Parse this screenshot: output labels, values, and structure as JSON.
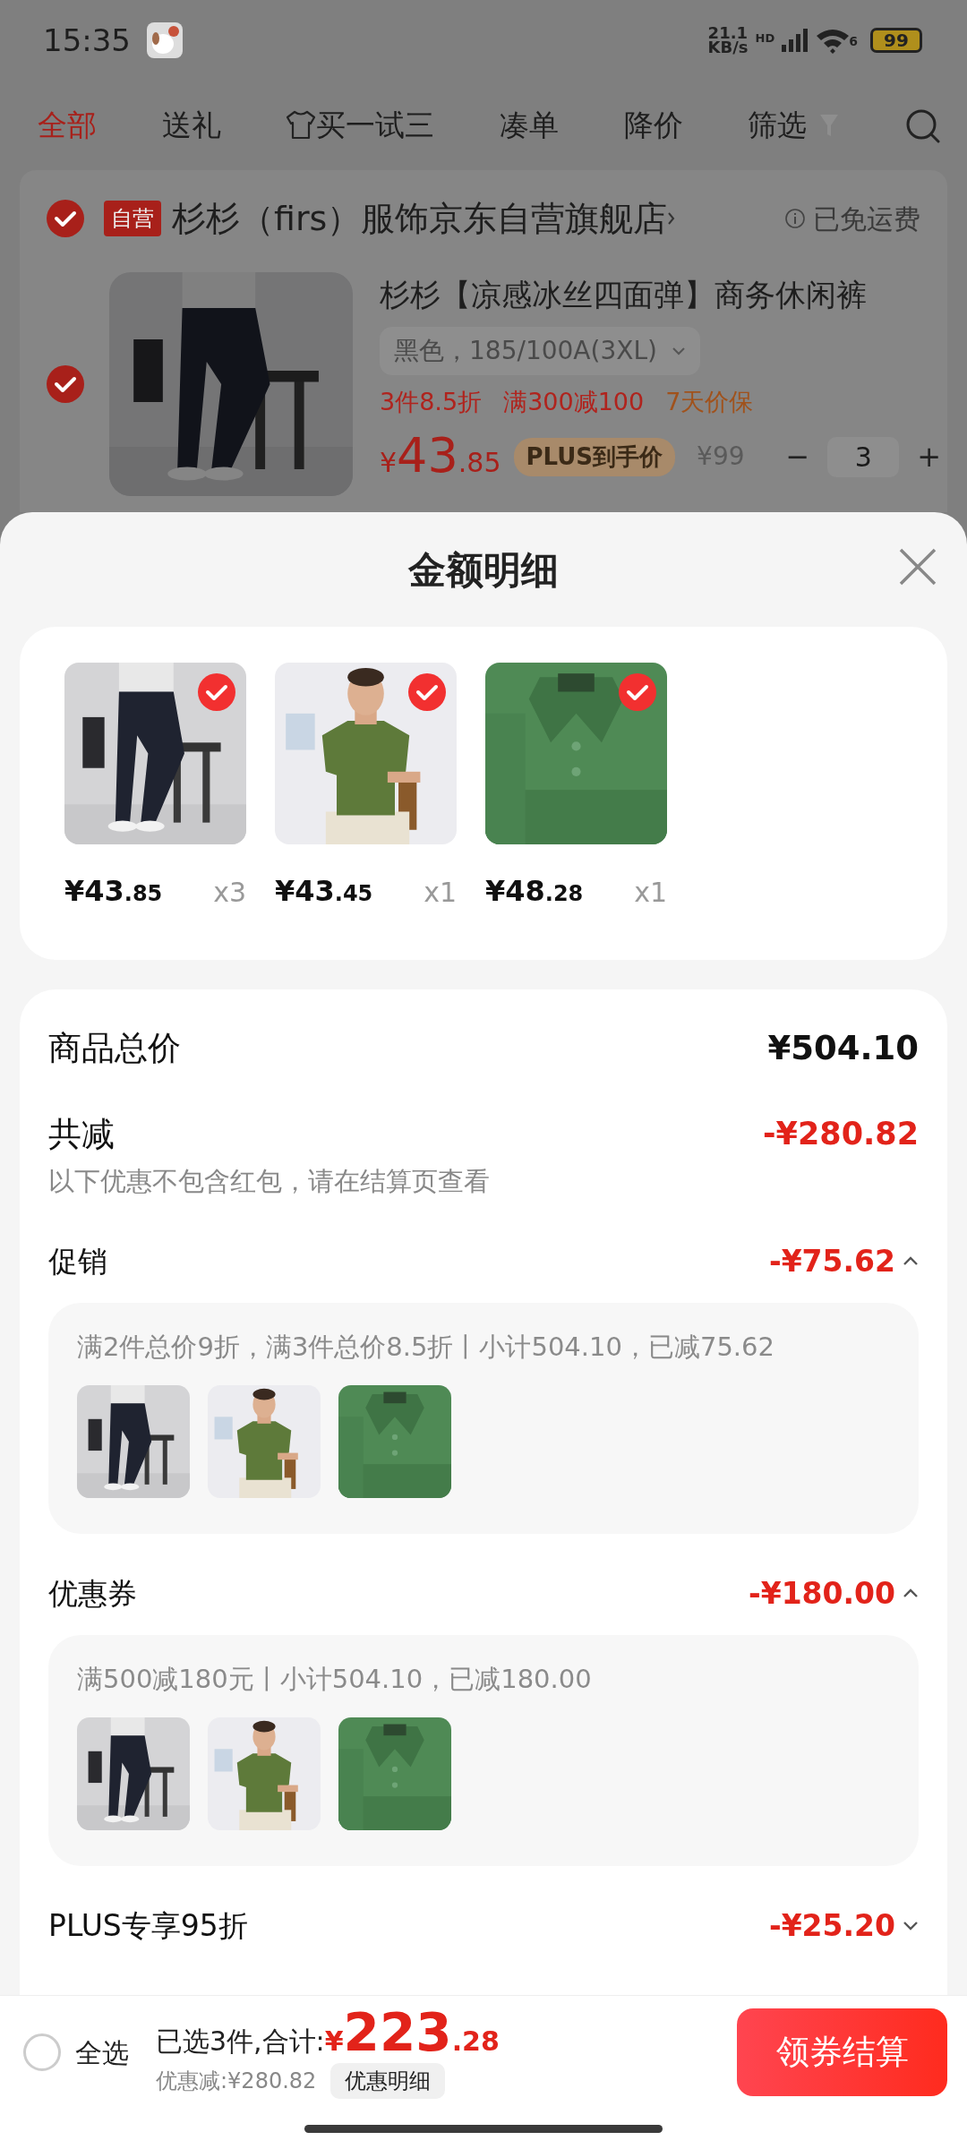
{
  "status_bar": {
    "time": "15:35",
    "net_speed": "21.1",
    "net_unit": "KB/s",
    "hd": "HD",
    "wifi_gen": "6",
    "battery": "99"
  },
  "filter_tabs": [
    {
      "label": "全部",
      "selected": true,
      "kind": "plain"
    },
    {
      "label": "送礼",
      "selected": false,
      "kind": "plain"
    },
    {
      "label": "买一试三",
      "selected": false,
      "kind": "shirt"
    },
    {
      "label": "凑单",
      "selected": false,
      "kind": "plain"
    },
    {
      "label": "降价",
      "selected": false,
      "kind": "plain"
    },
    {
      "label": "筛选",
      "selected": false,
      "kind": "filter"
    }
  ],
  "store": {
    "checked": true,
    "badge": "自营",
    "name": "杉杉（firs）服饰京东自营旗舰店",
    "shipping": "已免运费"
  },
  "cart_item": {
    "checked": true,
    "title": "杉杉【凉感冰丝四面弹】商务休闲裤",
    "variant": "黑色，185/100A(3XL)",
    "tags": [
      {
        "text": "3件8.5折",
        "color": "#b0231d"
      },
      {
        "text": "满300减100",
        "color": "#b0231d"
      },
      {
        "text": "7天价保",
        "color": "#a0521c"
      }
    ],
    "price_currency": "¥",
    "price_int": "43",
    "price_dec": ".85",
    "plus_label": "PLUS到手价",
    "original_price": "¥99",
    "qty_minus": "−",
    "qty": "3",
    "qty_plus": "+"
  },
  "sheet": {
    "title": "金额明细",
    "products": [
      {
        "price_int": "¥43",
        "price_dec": ".85",
        "qty": "x3",
        "selected": true
      },
      {
        "price_int": "¥43",
        "price_dec": ".45",
        "qty": "x1",
        "selected": true
      },
      {
        "price_int": "¥48",
        "price_dec": ".28",
        "qty": "x1",
        "selected": true
      }
    ],
    "total_label": "商品总价",
    "total": "¥504.10",
    "discount_label": "共减",
    "discount": "-¥280.82",
    "note": "以下优惠不包含红包，请在结算页查看",
    "sections": [
      {
        "label": "促销",
        "amount": "-¥75.62",
        "expanded": true,
        "detail": "满2件总价9折，满3件总价8.5折丨小计504.10，已减75.62"
      },
      {
        "label": "优惠券",
        "amount": "-¥180.00",
        "expanded": true,
        "detail": "满500减180元丨小计504.10，已减180.00"
      },
      {
        "label": "PLUS专享95折",
        "amount": "-¥25.20",
        "expanded": false
      }
    ]
  },
  "bottom_bar": {
    "select_all_checked": false,
    "select_all": "全选",
    "summary": "已选3件,合计:",
    "total_currency": "¥",
    "total_int": "223",
    "total_dec": ".28",
    "saved": "优惠减:¥280.82",
    "detail_button": "优惠明细",
    "checkout": "领券结算"
  }
}
